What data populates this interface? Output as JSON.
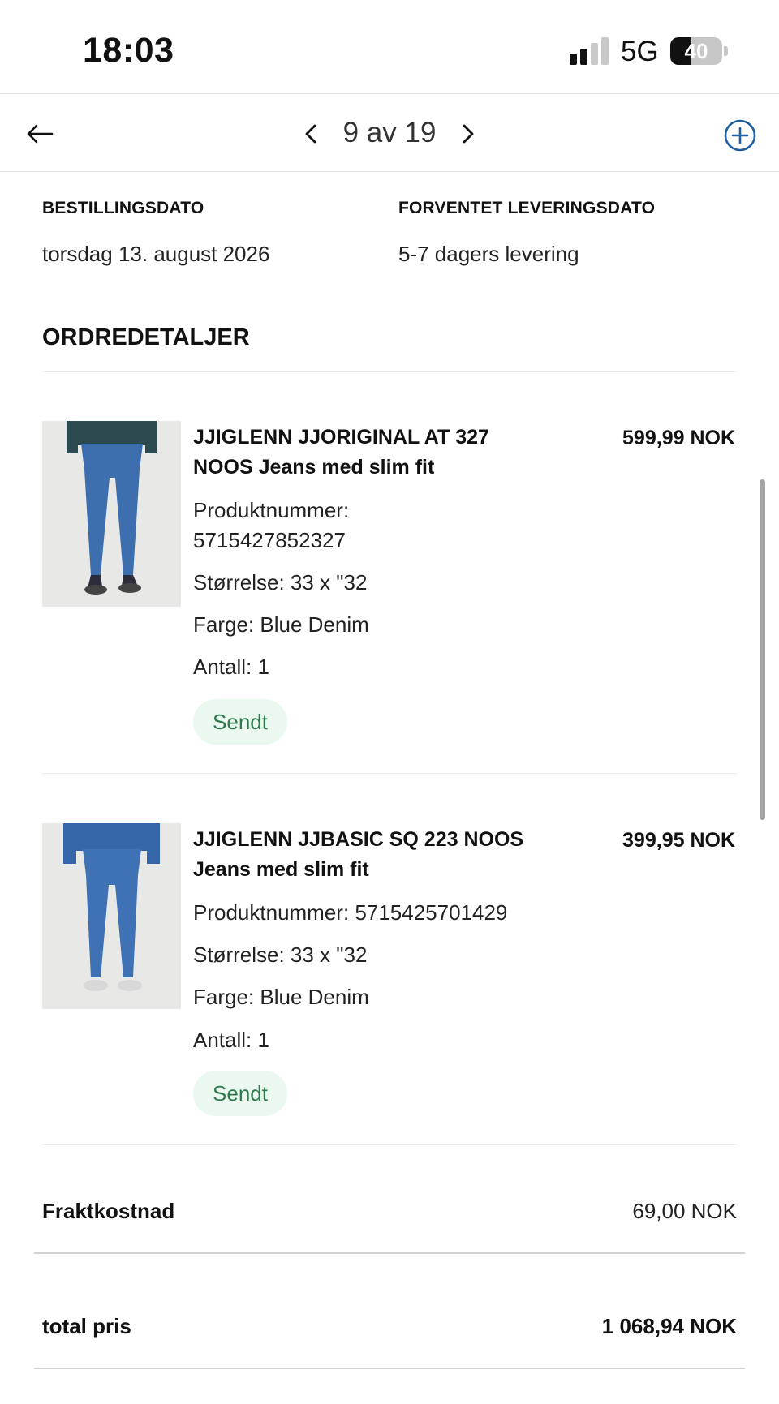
{
  "status_bar": {
    "time": "18:03",
    "network": "5G",
    "battery": "40",
    "battery_level": 0.4
  },
  "nav": {
    "back_icon": "arrow-left-icon",
    "pager_text": "9 av 19",
    "prev_icon": "chevron-left-icon",
    "next_icon": "chevron-right-icon",
    "add_icon": "plus-circle-icon",
    "accent_color": "#1f5fa0"
  },
  "order": {
    "order_date_label": "BESTILLINGSDATO",
    "order_date": "torsdag 13. august 2026",
    "delivery_label": "FORVENTET LEVERINGSDATO",
    "delivery_value": "5-7 dagers levering"
  },
  "details_title": "ORDREDETALJER",
  "items": [
    {
      "title_line1": "JJIGLENN JJORIGINAL AT 327",
      "title_line2": "NOOS Jeans med slim fit",
      "price": "599,99 NOK",
      "product_number_label": "Produktnummer:",
      "product_number": "5715427852327",
      "size": "Størrelse: 33 x \"32",
      "color": "Farge: Blue Denim",
      "quantity": "Antall: 1",
      "status": "Sendt"
    },
    {
      "title_line1": "JJIGLENN JJBASIC SQ 223 NOOS",
      "title_line2": "Jeans med slim fit",
      "price": "399,95 NOK",
      "product_number_full": "Produktnummer: 5715425701429",
      "size": "Størrelse: 33 x \"32",
      "color": "Farge: Blue Denim",
      "quantity": "Antall: 1",
      "status": "Sendt"
    }
  ],
  "summary": {
    "shipping_label": "Fraktkostnad",
    "shipping_value": "69,00 NOK",
    "total_label": "total pris",
    "total_value": "1 068,94 NOK"
  },
  "colors": {
    "badge_bg": "#eaf8ef",
    "badge_text": "#2f7a4d",
    "denim": "#3d6fae"
  }
}
